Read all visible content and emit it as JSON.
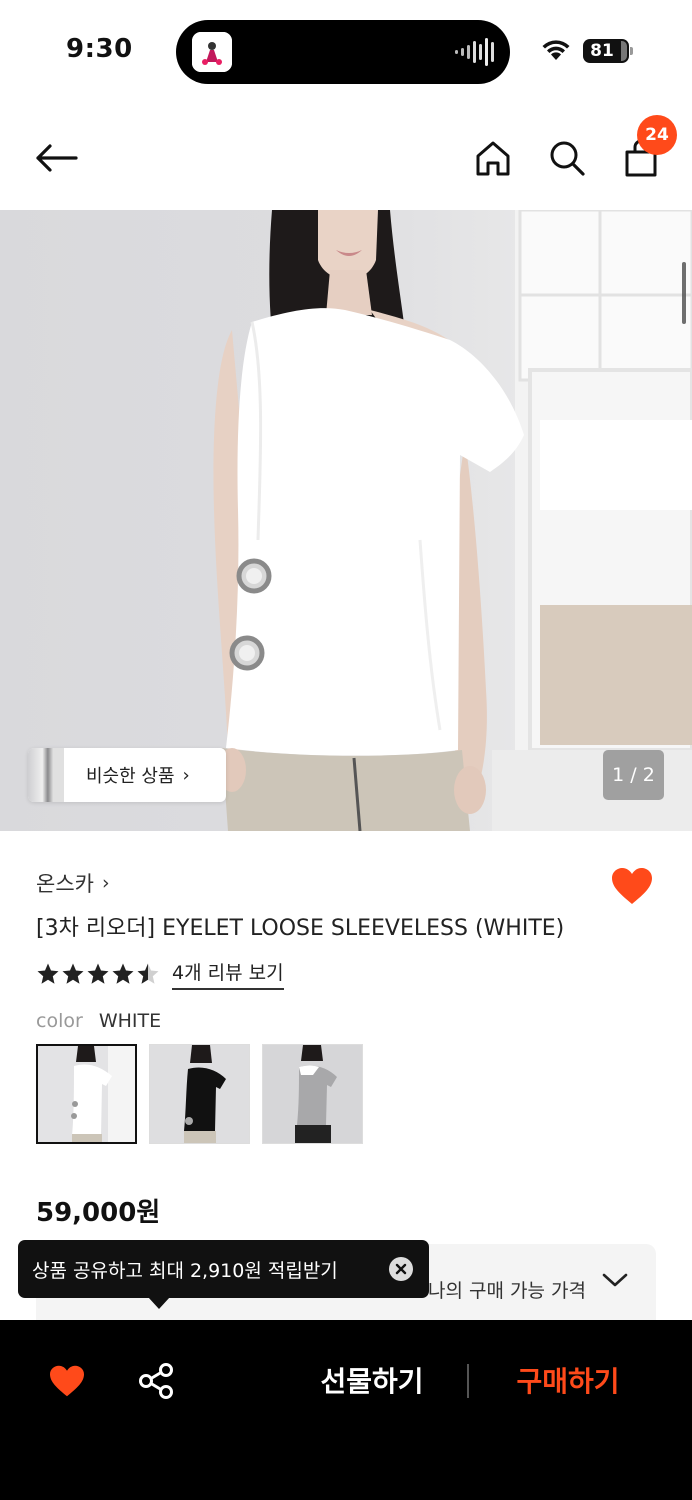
{
  "status_bar": {
    "time": "9:30",
    "battery": "81",
    "icons": [
      "wifi-icon",
      "battery-icon",
      "audio-wave-icon"
    ]
  },
  "nav": {
    "icons": [
      "back-arrow-icon",
      "home-icon",
      "search-icon",
      "cart-icon"
    ],
    "cart_count": "24"
  },
  "gallery": {
    "similar_label": "비슷한 상품",
    "similar_chevron": "›",
    "counter": "1 / 2"
  },
  "product": {
    "brand": "온스카",
    "brand_chevron": "›",
    "title": "[3차 리오더] EYELET LOOSE SLEEVELESS (WHITE)",
    "rating": 4.5,
    "review_link": "4개 리뷰 보기",
    "color_label": "color",
    "color_value": "WHITE",
    "swatch_count": 3,
    "price": "59,000원"
  },
  "price_panel": {
    "text": "나의 구매 가능 가격"
  },
  "tooltip": {
    "text": "상품 공유하고 최대 2,910원 적립받기"
  },
  "bottom_bar": {
    "gift_label": "선물하기",
    "buy_label": "구매하기"
  },
  "colors": {
    "accent": "#FF4A1A",
    "heart": "#FF4A1A",
    "bottom_bar": "#000000"
  }
}
